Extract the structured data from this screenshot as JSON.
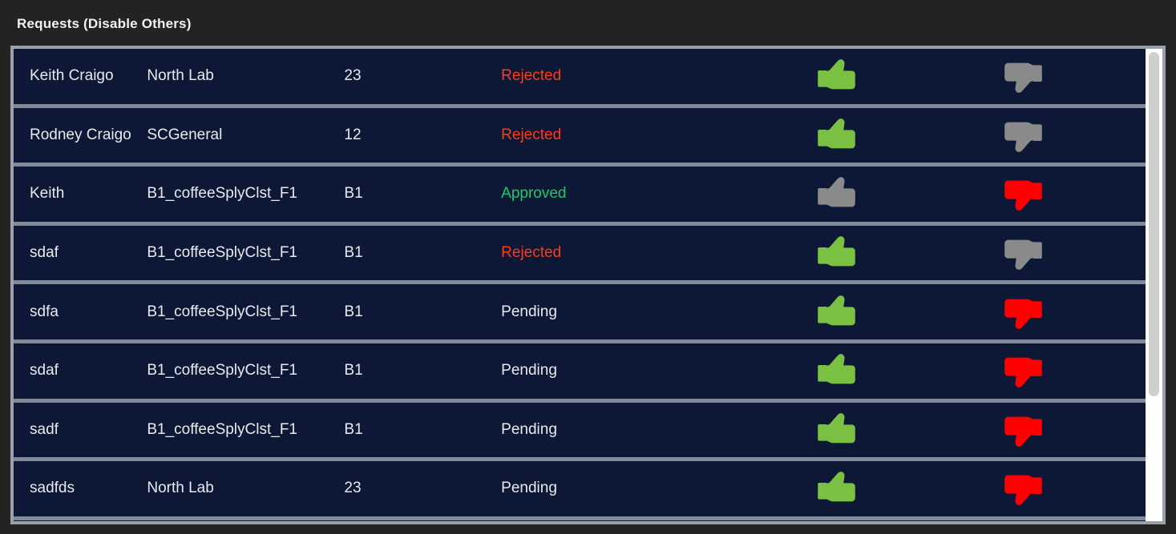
{
  "panel": {
    "title": "Requests (Disable Others)"
  },
  "colors": {
    "page_background": "#232323",
    "row_background": "#0d1736",
    "row_separator": "#808a99",
    "frame_border": "#9aa0a8",
    "status_rejected": "#ff3c14",
    "status_approved": "#1ec969",
    "status_pending": "#e8eaed",
    "thumb_active_up": "#7ac043",
    "thumb_active_down": "#ff0000",
    "thumb_disabled": "#8a8a8a",
    "scrollbar_track": "#ffffff",
    "scrollbar_thumb": "#cfcfcf"
  },
  "icons": {
    "approve": "thumbs-up-icon",
    "reject": "thumbs-down-icon"
  },
  "scrollbar": {
    "orientation": "vertical",
    "thumb_position_percent": 0,
    "thumb_size_percent": 73
  },
  "table": {
    "rows": [
      {
        "requester": "Keith Craigo",
        "resource": "North Lab",
        "code": "23",
        "status": "Rejected",
        "status_state": "rejected",
        "approve_enabled": true,
        "reject_enabled": false
      },
      {
        "requester": "Rodney Craigo",
        "resource": "SCGeneral",
        "code": "12",
        "status": "Rejected",
        "status_state": "rejected",
        "approve_enabled": true,
        "reject_enabled": false
      },
      {
        "requester": "Keith",
        "resource": "B1_coffeeSplyClst_F1",
        "code": "B1",
        "status": "Approved",
        "status_state": "approved",
        "approve_enabled": false,
        "reject_enabled": true
      },
      {
        "requester": "sdaf",
        "resource": "B1_coffeeSplyClst_F1",
        "code": "B1",
        "status": "Rejected",
        "status_state": "rejected",
        "approve_enabled": true,
        "reject_enabled": false
      },
      {
        "requester": "sdfa",
        "resource": "B1_coffeeSplyClst_F1",
        "code": "B1",
        "status": "Pending",
        "status_state": "pending",
        "approve_enabled": true,
        "reject_enabled": true
      },
      {
        "requester": "sdaf",
        "resource": "B1_coffeeSplyClst_F1",
        "code": "B1",
        "status": "Pending",
        "status_state": "pending",
        "approve_enabled": true,
        "reject_enabled": true
      },
      {
        "requester": "sadf",
        "resource": "B1_coffeeSplyClst_F1",
        "code": "B1",
        "status": "Pending",
        "status_state": "pending",
        "approve_enabled": true,
        "reject_enabled": true
      },
      {
        "requester": "sadfds",
        "resource": "North Lab",
        "code": "23",
        "status": "Pending",
        "status_state": "pending",
        "approve_enabled": true,
        "reject_enabled": true
      }
    ]
  }
}
